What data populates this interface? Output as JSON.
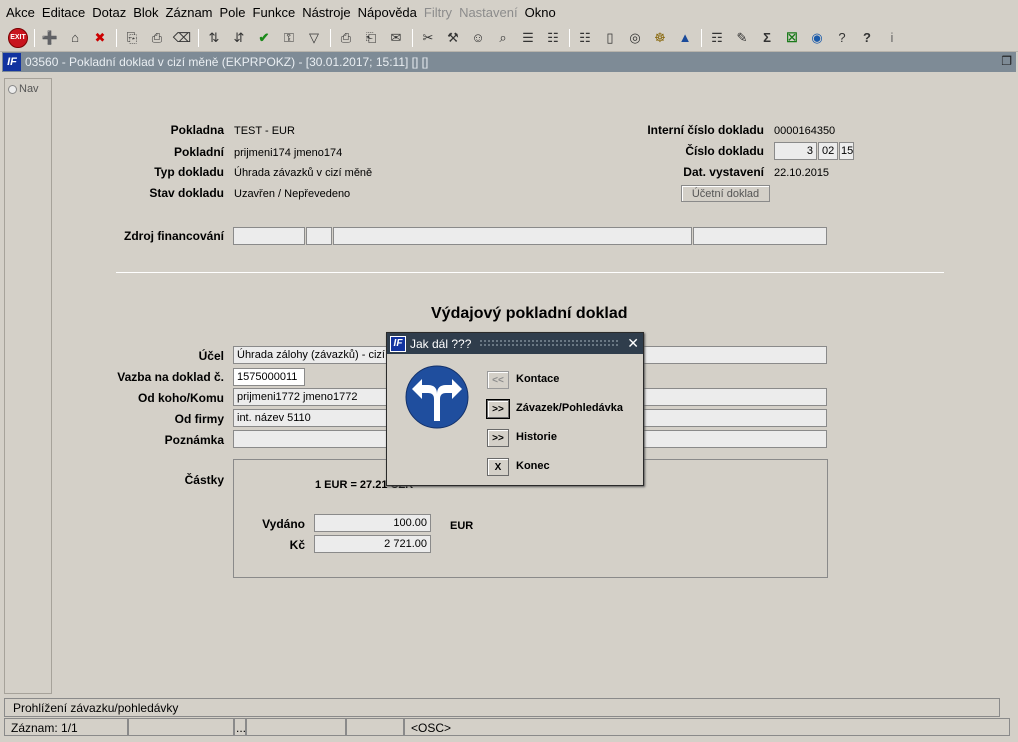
{
  "menu": [
    "Akce",
    "Editace",
    "Dotaz",
    "Blok",
    "Záznam",
    "Pole",
    "Funkce",
    "Nástroje",
    "Nápověda",
    "Filtry",
    "Nastavení",
    "Okno"
  ],
  "menu_disabled": [
    "Filtry",
    "Nastavení"
  ],
  "toolbar": {
    "exit_label": "EXIT",
    "groups": [
      [
        "exit-icon"
      ],
      [
        "insert-record-icon",
        "save-icon",
        "delete-record-icon"
      ],
      [
        "copy-icon",
        "paste-icon",
        "clear-icon"
      ],
      [
        "sort-ascending-icon",
        "sort-descending-icon",
        "checkmark-icon",
        "key-icon",
        "filter-icon"
      ],
      [
        "print-icon",
        "print-preview-icon",
        "mail-icon"
      ],
      [
        "cut-icon",
        "tools-icon",
        "users-icon",
        "search-users-icon",
        "list-icon",
        "tree-icon"
      ],
      [
        "report-icon",
        "document-icon",
        "globe-icon",
        "settings-icon",
        "chart-icon"
      ],
      [
        "graph-icon",
        "edit-doc-icon",
        "sum-icon",
        "excel-icon",
        "web-icon",
        "help-index-icon",
        "help-icon",
        "info-icon"
      ]
    ]
  },
  "window": {
    "title": "03560 - Pokladní doklad v cizí měně (EKPRPOKZ) - [30.01.2017; 15:11]  []  []",
    "logo": "IF"
  },
  "nav": {
    "label": "Nav"
  },
  "header": {
    "pokladna_label": "Pokladna",
    "pokladna_value": "TEST - EUR",
    "pokladni_label": "Pokladní",
    "pokladni_value": "prijmeni174 jmeno174",
    "typ_label": "Typ dokladu",
    "typ_value": "Úhrada závazků v cizí měně",
    "stav_label": "Stav dokladu",
    "stav_value": "Uzavřen / Nepřevedeno",
    "interni_label": "Interní číslo dokladu",
    "interni_value": "0000164350",
    "cislo_label": "Číslo dokladu",
    "cislo_1": "3",
    "cislo_2": "02",
    "cislo_3": "15",
    "datum_label": "Dat. vystavení",
    "datum_value": "22.10.2015",
    "ucetni_button": "Účetní doklad",
    "zdroj_label": "Zdroj financování"
  },
  "section_title": "Výdajový pokladní doklad",
  "details": {
    "ucel_label": "Účel",
    "ucel_value": "Úhrada zálohy (závazků) - cizí",
    "vazba_label": "Vazba na doklad č.",
    "vazba_value": "1575000011",
    "odkoho_label": "Od koho/Komu",
    "odkoho_value": "prijmeni1772 jmeno1772",
    "odfirmy_label": "Od firmy",
    "odfirmy_value": "int. název 5110",
    "poznamka_label": "Poznámka"
  },
  "amounts": {
    "label": "Částky",
    "rate": "1 EUR = 27.21 CZK",
    "vydano_label": "Vydáno",
    "vydano_value": "100.00",
    "currency": "EUR",
    "kc_label": "Kč",
    "kc_value": "2 721.00"
  },
  "dialog": {
    "title": "Jak dál ???",
    "close": "✕",
    "options": [
      {
        "button": "<<",
        "label": "Kontace",
        "disabled": true
      },
      {
        "button": ">>",
        "label": "Závazek/Pohledávka",
        "focused": true
      },
      {
        "button": ">>",
        "label": "Historie"
      },
      {
        "button": "X",
        "label": "Konec"
      }
    ]
  },
  "status": {
    "message": "Prohlížení závazku/pohledávky",
    "record": "Záznam: 1/1",
    "dots": "...",
    "mode": "<OSC>"
  }
}
